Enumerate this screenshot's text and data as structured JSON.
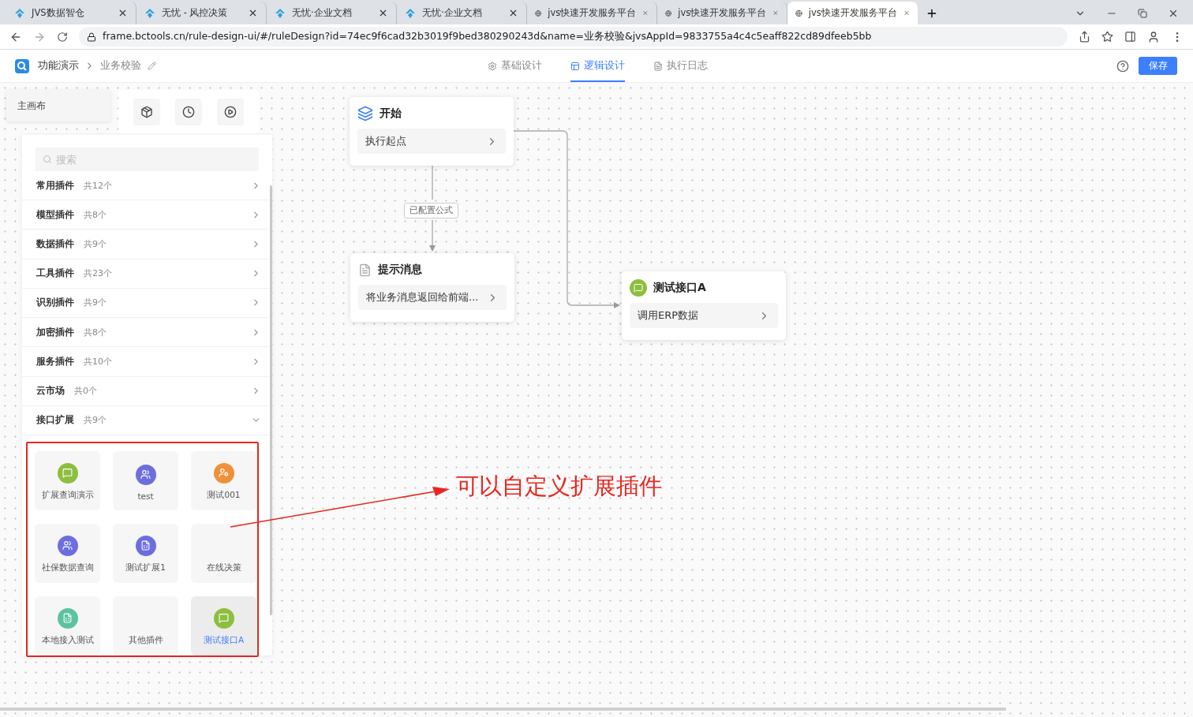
{
  "browser": {
    "tabs": [
      {
        "title": "JVS数据智仓",
        "kind": "logo",
        "selected": false
      },
      {
        "title": "无忧 - 风控决策",
        "kind": "logo",
        "selected": false
      },
      {
        "title": "无忧·企业文档",
        "kind": "logo",
        "selected": false
      },
      {
        "title": "无忧·企业文档",
        "kind": "logo",
        "selected": false
      },
      {
        "title": "jvs快速开发服务平台",
        "kind": "globe",
        "selected": false
      },
      {
        "title": "jvs快速开发服务平台",
        "kind": "globe",
        "selected": false
      },
      {
        "title": "jvs快速开发服务平台",
        "kind": "globe",
        "selected": true
      }
    ],
    "address": "frame.bctools.cn/rule-design-ui/#/ruleDesign?id=74ec9f6cad32b3019f9bed380290243d&name=业务校验&jvsAppId=9833755a4c4c5eaff822cd89dfeeb5bb"
  },
  "header": {
    "breadcrumb": [
      "功能演示",
      "业务校验"
    ],
    "tabs": [
      {
        "label": "基础设计",
        "kind": "gear",
        "selected": false
      },
      {
        "label": "逻辑设计",
        "kind": "layout",
        "selected": true
      },
      {
        "label": "执行日志",
        "kind": "file",
        "selected": false
      }
    ],
    "save": "保存"
  },
  "sidebar": {
    "canvas_tab": "主画布",
    "search": {
      "placeholder": "搜索"
    },
    "groups": [
      {
        "name": "常用插件",
        "count": "共12个",
        "expanded": false
      },
      {
        "name": "模型插件",
        "count": "共8个",
        "expanded": false
      },
      {
        "name": "数据插件",
        "count": "共9个",
        "expanded": false
      },
      {
        "name": "工具插件",
        "count": "共23个",
        "expanded": false
      },
      {
        "name": "识别插件",
        "count": "共9个",
        "expanded": false
      },
      {
        "name": "加密插件",
        "count": "共8个",
        "expanded": false
      },
      {
        "name": "服务插件",
        "count": "共10个",
        "expanded": false
      },
      {
        "name": "云市场",
        "count": "共0个",
        "expanded": false
      },
      {
        "name": "接口扩展",
        "count": "共9个",
        "expanded": true
      }
    ],
    "plugins": [
      {
        "label": "扩展查询演示",
        "color": "#8cbf3f",
        "selected": false
      },
      {
        "label": "test",
        "color": "#6c6ee0",
        "selected": false
      },
      {
        "label": "测试001",
        "color": "#f0913a",
        "selected": false
      },
      {
        "label": "社保数据查询",
        "color": "#6c6ee0",
        "selected": false
      },
      {
        "label": "测试扩展1",
        "color": "#6c6ee0",
        "selected": false
      },
      {
        "label": "在线决策",
        "selected": false
      },
      {
        "label": "本地接入测试",
        "color": "#5cc3a0",
        "selected": false
      },
      {
        "label": "其他插件",
        "selected": false
      },
      {
        "label": "测试接口A",
        "color": "#8cbf3f",
        "selected": true
      }
    ]
  },
  "canvas": {
    "nodes": [
      {
        "kind": "start",
        "title": "开始",
        "action": "执行起点"
      },
      {
        "kind": "message",
        "title": "提示消息",
        "action": "将业务消息返回给前端..."
      },
      {
        "kind": "plugin",
        "title": "测试接口A",
        "action": "调用ERP数据",
        "color": "#8cbf3f"
      }
    ],
    "edge_label": "已配置公式"
  },
  "annotation": {
    "text": "可以自定义扩展插件"
  }
}
